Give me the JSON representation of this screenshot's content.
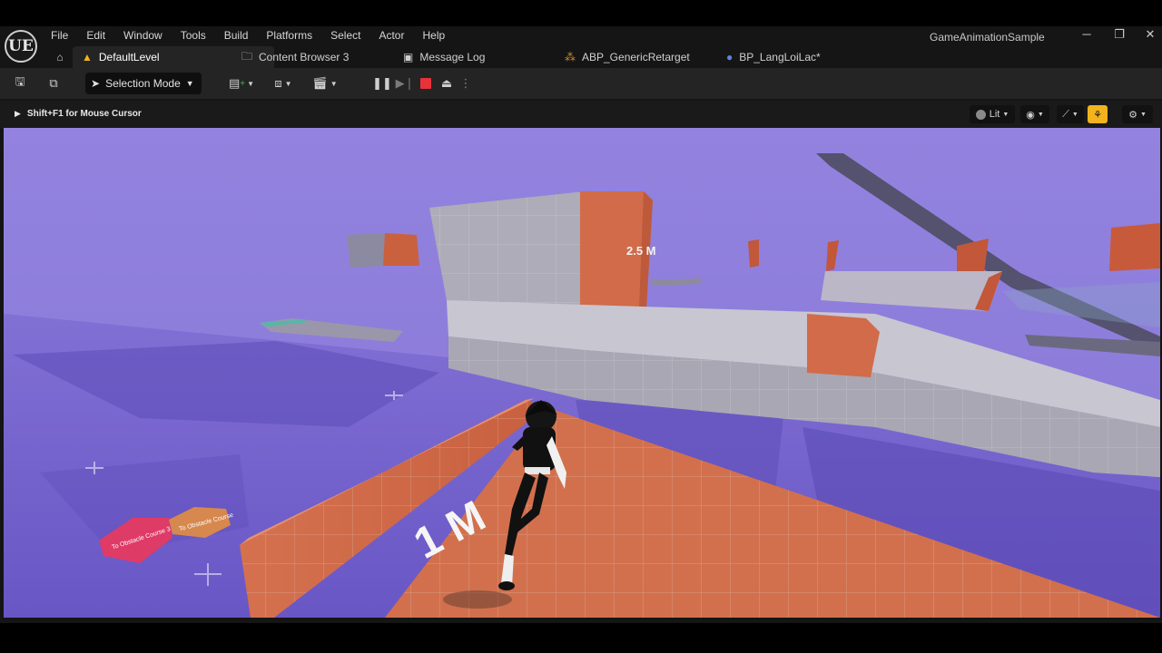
{
  "app": {
    "logo": "UE",
    "project_name": "GameAnimationSample"
  },
  "menu": [
    "File",
    "Edit",
    "Window",
    "Tools",
    "Build",
    "Platforms",
    "Select",
    "Actor",
    "Help"
  ],
  "window_controls": {
    "minimize": "─",
    "restore": "❐",
    "close": "✕"
  },
  "tabs": [
    {
      "label": "DefaultLevel",
      "icon": "level-icon",
      "active": true
    },
    {
      "label": "Content Browser 3",
      "icon": "folder-icon",
      "active": false
    },
    {
      "label": "Message Log",
      "icon": "log-icon",
      "active": false
    },
    {
      "label": "ABP_GenericRetarget",
      "icon": "anim-blueprint-icon",
      "active": false
    },
    {
      "label": "BP_LangLoiLac*",
      "icon": "blueprint-icon",
      "active": false
    }
  ],
  "toolbar": {
    "selection_mode": "Selection Mode"
  },
  "viewport": {
    "hint": "Shift+F1 for Mouse Cursor",
    "view_mode": "Lit",
    "labels": {
      "wall_short": "1 M",
      "wall_tall": "2.5 M",
      "sign_red": "To Obstacle Course 3",
      "sign_orange": "To Obstacle Course"
    }
  },
  "colors": {
    "accent": "#f2b31c",
    "stop_red": "#e8323a",
    "floor_purple": "#7b6ad1",
    "sky_purple": "#8c7bdc",
    "orange_block": "#d7714e"
  }
}
